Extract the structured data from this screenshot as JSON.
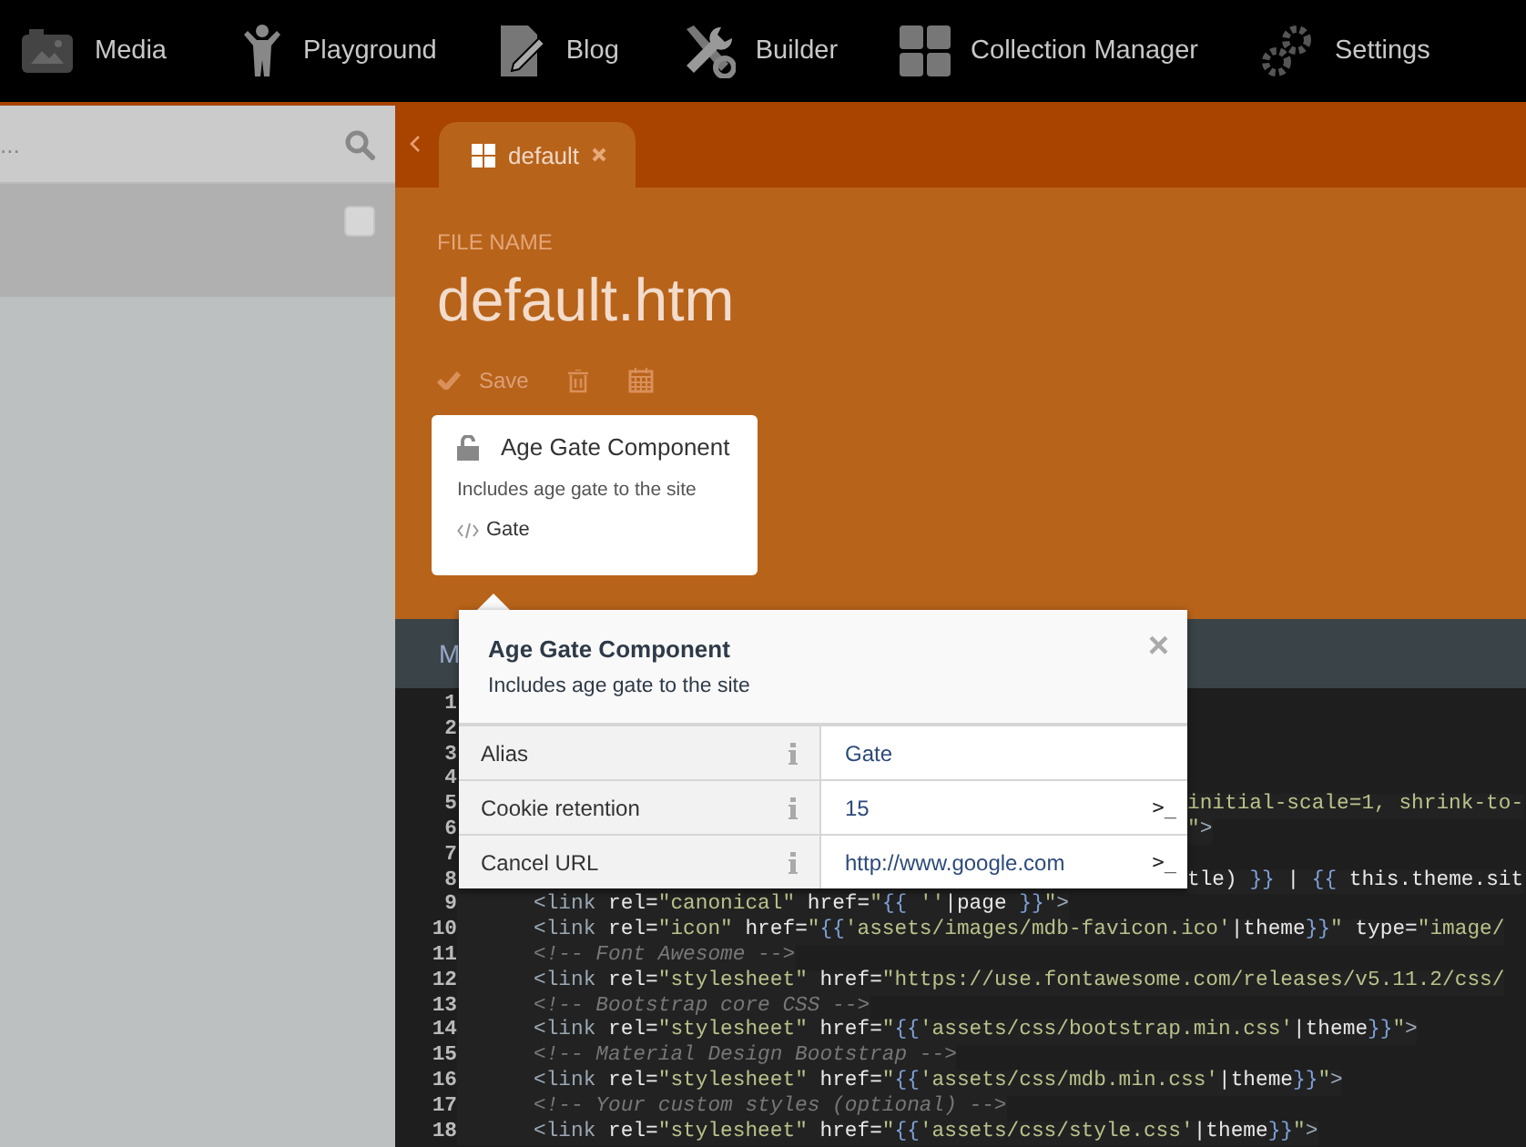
{
  "nav": [
    {
      "label": "Media",
      "kind": "media"
    },
    {
      "label": "Playground",
      "kind": "person"
    },
    {
      "label": "Blog",
      "kind": "doc"
    },
    {
      "label": "Builder",
      "kind": "tools"
    },
    {
      "label": "Collection Manager",
      "kind": "grid"
    },
    {
      "label": "Settings",
      "kind": "gears"
    }
  ],
  "sidebar": {
    "search": {
      "placeholder": "..."
    },
    "items": [
      {
        "checked": false
      }
    ]
  },
  "tabs": [
    {
      "label": "default",
      "selected": true
    }
  ],
  "file": {
    "field_label": "FILE NAME",
    "name": "default.htm",
    "save_label": "Save"
  },
  "component_card": {
    "title": "Age Gate Component",
    "description": "Includes age gate to the site",
    "alias": "Gate"
  },
  "editor": {
    "tab_label": "M",
    "lines": [
      {
        "number": "1"
      },
      {
        "number": "2"
      },
      {
        "number": "3"
      },
      {
        "number": "4"
      },
      {
        "number": "5",
        "kind": "partial",
        "tokens": [
          {
            "kind": "str",
            "text": "initial-scale=1, shrink-to-"
          }
        ]
      },
      {
        "number": "6",
        "kind": "partial",
        "tokens": [
          {
            "kind": "str",
            "text": "\""
          },
          {
            "kind": "tag",
            "text": ">"
          }
        ]
      },
      {
        "number": "7"
      },
      {
        "number": "8",
        "kind": "partial",
        "tokens": [
          {
            "kind": "attr",
            "text": "tle) "
          },
          {
            "kind": "brace",
            "text": "}}"
          },
          {
            "kind": "attr",
            "text": " | "
          },
          {
            "kind": "brace",
            "text": "{{"
          },
          {
            "kind": "attr",
            "text": " this.theme.sit"
          }
        ]
      },
      {
        "number": "9",
        "kind": "full",
        "tokens": [
          {
            "kind": "tag",
            "text": "<link"
          },
          {
            "kind": "attr",
            "text": " rel="
          },
          {
            "kind": "str",
            "text": "\"canonical\""
          },
          {
            "kind": "attr",
            "text": " href="
          },
          {
            "kind": "str",
            "text": "\""
          },
          {
            "kind": "brace",
            "text": "{{"
          },
          {
            "kind": "str",
            "text": " ''"
          },
          {
            "kind": "attr",
            "text": "|page "
          },
          {
            "kind": "brace",
            "text": "}}"
          },
          {
            "kind": "str",
            "text": "\""
          },
          {
            "kind": "tag",
            "text": ">"
          }
        ]
      },
      {
        "number": "10",
        "kind": "full",
        "tokens": [
          {
            "kind": "tag",
            "text": "<link"
          },
          {
            "kind": "attr",
            "text": " rel="
          },
          {
            "kind": "str",
            "text": "\"icon\""
          },
          {
            "kind": "attr",
            "text": " href="
          },
          {
            "kind": "str",
            "text": "\""
          },
          {
            "kind": "brace",
            "text": "{{"
          },
          {
            "kind": "str",
            "text": "'assets/images/mdb-favicon.ico'"
          },
          {
            "kind": "attr",
            "text": "|theme"
          },
          {
            "kind": "brace",
            "text": "}}"
          },
          {
            "kind": "str",
            "text": "\""
          },
          {
            "kind": "attr",
            "text": " type="
          },
          {
            "kind": "str",
            "text": "\"image/"
          }
        ]
      },
      {
        "number": "11",
        "kind": "full",
        "tokens": [
          {
            "kind": "comment",
            "text": "<!-- Font Awesome -->"
          }
        ]
      },
      {
        "number": "12",
        "kind": "full",
        "tokens": [
          {
            "kind": "tag",
            "text": "<link"
          },
          {
            "kind": "attr",
            "text": " rel="
          },
          {
            "kind": "str",
            "text": "\"stylesheet\""
          },
          {
            "kind": "attr",
            "text": " href="
          },
          {
            "kind": "str",
            "text": "\"https://use.fontawesome.com/releases/v5.11.2/css/"
          }
        ]
      },
      {
        "number": "13",
        "kind": "full",
        "tokens": [
          {
            "kind": "comment",
            "text": "<!-- Bootstrap core CSS -->"
          }
        ]
      },
      {
        "number": "14",
        "kind": "full",
        "tokens": [
          {
            "kind": "tag",
            "text": "<link"
          },
          {
            "kind": "attr",
            "text": " rel="
          },
          {
            "kind": "str",
            "text": "\"stylesheet\""
          },
          {
            "kind": "attr",
            "text": " href="
          },
          {
            "kind": "str",
            "text": "\""
          },
          {
            "kind": "brace",
            "text": "{{"
          },
          {
            "kind": "str",
            "text": "'assets/css/bootstrap.min.css'"
          },
          {
            "kind": "attr",
            "text": "|theme"
          },
          {
            "kind": "brace",
            "text": "}}"
          },
          {
            "kind": "str",
            "text": "\""
          },
          {
            "kind": "tag",
            "text": ">"
          }
        ]
      },
      {
        "number": "15",
        "kind": "full",
        "tokens": [
          {
            "kind": "comment",
            "text": "<!-- Material Design Bootstrap -->"
          }
        ]
      },
      {
        "number": "16",
        "kind": "full",
        "tokens": [
          {
            "kind": "tag",
            "text": "<link"
          },
          {
            "kind": "attr",
            "text": " rel="
          },
          {
            "kind": "str",
            "text": "\"stylesheet\""
          },
          {
            "kind": "attr",
            "text": " href="
          },
          {
            "kind": "str",
            "text": "\""
          },
          {
            "kind": "brace",
            "text": "{{"
          },
          {
            "kind": "str",
            "text": "'assets/css/mdb.min.css'"
          },
          {
            "kind": "attr",
            "text": "|theme"
          },
          {
            "kind": "brace",
            "text": "}}"
          },
          {
            "kind": "str",
            "text": "\""
          },
          {
            "kind": "tag",
            "text": ">"
          }
        ]
      },
      {
        "number": "17",
        "kind": "full",
        "tokens": [
          {
            "kind": "comment",
            "text": "<!-- Your custom styles (optional) -->"
          }
        ]
      },
      {
        "number": "18",
        "kind": "full",
        "tokens": [
          {
            "kind": "tag",
            "text": "<link"
          },
          {
            "kind": "attr",
            "text": " rel="
          },
          {
            "kind": "str",
            "text": "\"stylesheet\""
          },
          {
            "kind": "attr",
            "text": " href="
          },
          {
            "kind": "str",
            "text": "\""
          },
          {
            "kind": "brace",
            "text": "{{"
          },
          {
            "kind": "str",
            "text": "'assets/css/style.css'"
          },
          {
            "kind": "attr",
            "text": "|theme"
          },
          {
            "kind": "brace",
            "text": "}}"
          },
          {
            "kind": "str",
            "text": "\""
          },
          {
            "kind": "tag",
            "text": ">"
          }
        ]
      }
    ]
  },
  "popup": {
    "title": "Age Gate Component",
    "description": "Includes age gate to the site",
    "close": "×",
    "properties": [
      {
        "label": "Alias",
        "value": "Gate"
      },
      {
        "label": "Cookie retention",
        "value": "15",
        "action": ">_"
      },
      {
        "label": "Cancel URL",
        "value": "http://www.google.com",
        "action": ">_"
      }
    ]
  }
}
